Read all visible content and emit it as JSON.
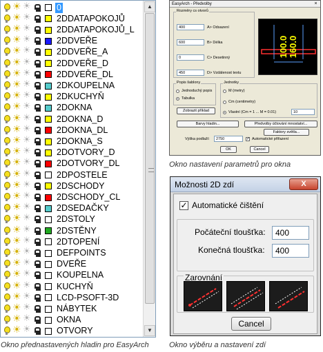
{
  "layers": [
    {
      "name": "0",
      "color": "#ffffff",
      "selected": true
    },
    {
      "name": "2DDATAPOKOJŮ",
      "color": "#ffff00"
    },
    {
      "name": "2DDATAPOKOJŮ_L",
      "color": "#ffff00"
    },
    {
      "name": "2DDVEŘE",
      "color": "#1a1aff"
    },
    {
      "name": "2DDVEŘE_A",
      "color": "#ffff00"
    },
    {
      "name": "2DDVEŘE_D",
      "color": "#ffff00"
    },
    {
      "name": "2DDVEŘE_DL",
      "color": "#ff0000"
    },
    {
      "name": "2DKOUPELNA",
      "color": "#55cccc"
    },
    {
      "name": "2DKUCHYŇ",
      "color": "#ffff00"
    },
    {
      "name": "2DOKNA",
      "color": "#55cccc"
    },
    {
      "name": "2DOKNA_D",
      "color": "#ffff00"
    },
    {
      "name": "2DOKNA_DL",
      "color": "#ff0000"
    },
    {
      "name": "2DOKNA_S",
      "color": "#ffff00"
    },
    {
      "name": "2DOTVORY_D",
      "color": "#ffff00"
    },
    {
      "name": "2DOTVORY_DL",
      "color": "#ff0000"
    },
    {
      "name": "2DPOSTELE",
      "color": "#ffffff"
    },
    {
      "name": "2DSCHODY",
      "color": "#ffff00"
    },
    {
      "name": "2DSCHODY_CL",
      "color": "#ff0000"
    },
    {
      "name": "2DSEDAČKY",
      "color": "#55cccc"
    },
    {
      "name": "2DSTOLY",
      "color": "#ffffff"
    },
    {
      "name": "2DSTĚNY",
      "color": "#22aa22"
    },
    {
      "name": "2DTOPENÍ",
      "color": "#ffffff"
    },
    {
      "name": "DEFPOINTS",
      "color": "#ffffff"
    },
    {
      "name": "DVEŘE",
      "color": "#ffffff"
    },
    {
      "name": "KOUPELNA",
      "color": "#ffffff"
    },
    {
      "name": "KUCHYŇ",
      "color": "#ffffff"
    },
    {
      "name": "LCD-PSOFT-3D",
      "color": "#ffffff"
    },
    {
      "name": "NÁBYTEK",
      "color": "#ffffff"
    },
    {
      "name": "OKNA",
      "color": "#ffffff"
    },
    {
      "name": "OTVORY",
      "color": "#ffffff"
    }
  ],
  "captions": {
    "layers": "Okno přednastavených hladin pro EasyArch",
    "easyarch": "Okno nastavení parametrů pro okna",
    "walls": "Okno výběru a nastavení zdí"
  },
  "easyarch": {
    "title": "EasyArch - Předvolby",
    "close": "×",
    "dims_legend": "Rozměry cs otvorů",
    "fields": [
      {
        "value": "400",
        "label": "A> Odsazení"
      },
      {
        "value": "600",
        "label": "B> Délka"
      },
      {
        "value": "0",
        "label": "C> Desetinný"
      },
      {
        "value": "450",
        "label": "D> Vzdálenost textu"
      }
    ],
    "popis_legend": "Popis šablony",
    "popis_opt1": "Jednoduchý popis",
    "popis_opt2": "Tabulka",
    "units_legend": "Jednotky",
    "unit_m": "M (metry)",
    "unit_cm": "Cm (centimetry)",
    "unit_custom": "Vlastní (Cm = 1 ... M = 0.01)",
    "unit_custom_value": "10",
    "show_example": "Zobrazit příklad",
    "colors_btn": "Barvy hladin...",
    "presets_btn": "Předvolby účtování mnostatví...",
    "factors_btn": "Faktory světla...",
    "height_label": "Výška podlaží:",
    "height_value": "2750",
    "auto_clean": "Automatické přiřazení",
    "ok": "OK",
    "cancel": "Cancel",
    "preview_labels": [
      "100.0",
      "160.0"
    ]
  },
  "walls": {
    "title": "Možnosti 2D zdí",
    "close": "X",
    "auto_clean": "Automatické čištění",
    "start_label": "Počáteční tloušťka:",
    "start_value": "400",
    "end_label": "Konečná tloušťka:",
    "end_value": "400",
    "align_legend": "Zarovnání",
    "cancel": "Cancel"
  },
  "colors": {
    "selection": "#3399ff",
    "preview_bg": "#000000",
    "preview_accent": "#ffff00",
    "preview_line": "#ff3030",
    "preview_blue": "#5aa0ff"
  }
}
